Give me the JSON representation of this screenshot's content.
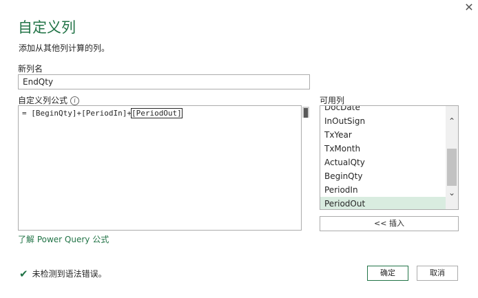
{
  "dialog": {
    "close_glyph": "✕",
    "title": "自定义列",
    "subtitle": "添加从其他列计算的列。"
  },
  "new_column": {
    "label": "新列名",
    "value": "EndQty"
  },
  "formula": {
    "label": "自定义列公式",
    "info_glyph": "i",
    "prefix": "= [BeginQty]+[PeriodIn]+",
    "selected": "[PeriodOut]"
  },
  "available_columns": {
    "label": "可用列",
    "items": [
      "DocDate",
      "InOutSign",
      "TxYear",
      "TxMonth",
      "ActualQty",
      "BeginQty",
      "PeriodIn",
      "PeriodOut"
    ],
    "selected": "PeriodOut",
    "insert_label": "<< 插入"
  },
  "learn_link": "了解 Power Query 公式",
  "status": {
    "text": "未检测到语法错误。",
    "icon": "check-icon"
  },
  "buttons": {
    "ok": "确定",
    "cancel": "取消"
  },
  "colors": {
    "accent": "#217346",
    "selected_row": "#d9ece0"
  }
}
